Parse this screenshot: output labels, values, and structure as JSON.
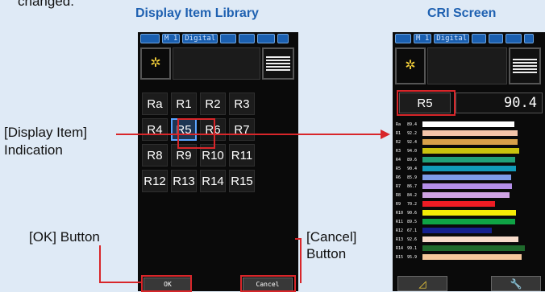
{
  "top_note": "changed.",
  "titles": {
    "library": "Display Item Library",
    "cri": "CRI Screen"
  },
  "annotations": {
    "display_item_line1": "[Display Item]",
    "display_item_line2": "Indication",
    "ok_button": "[OK] Button",
    "cancel_line1": "[Cancel]",
    "cancel_line2": "Button"
  },
  "status_bar": {
    "mode": "M 1",
    "digital": "Digital"
  },
  "icons": {
    "header_left": "sun-icon",
    "header_right": "list-menu-icon",
    "bottom_left": "triangle-ruler-icon",
    "bottom_right": "wrench-icon"
  },
  "library": {
    "items": [
      "Ra",
      "R1",
      "R2",
      "R3",
      "R4",
      "R5",
      "R6",
      "R7",
      "R8",
      "R9",
      "R10",
      "R11",
      "R12",
      "R13",
      "R14",
      "R15"
    ],
    "selected": "R5",
    "ok_label": "OK",
    "cancel_label": "Cancel"
  },
  "cri": {
    "item_label": "R5",
    "item_value": "90.4",
    "rows": [
      {
        "name": "Ra",
        "value": "89.4",
        "color": "#ffffff"
      },
      {
        "name": "R1",
        "value": "92.2",
        "color": "#f3c4a9"
      },
      {
        "name": "R2",
        "value": "92.4",
        "color": "#d7a04a"
      },
      {
        "name": "R3",
        "value": "94.0",
        "color": "#c9c20e"
      },
      {
        "name": "R4",
        "value": "89.6",
        "color": "#22a07a"
      },
      {
        "name": "R5",
        "value": "90.4",
        "color": "#119ab9"
      },
      {
        "name": "R6",
        "value": "85.9",
        "color": "#7e9be8"
      },
      {
        "name": "R7",
        "value": "86.7",
        "color": "#b48ee8"
      },
      {
        "name": "R8",
        "value": "84.2",
        "color": "#cfa3e3"
      },
      {
        "name": "R9",
        "value": "70.2",
        "color": "#ee1c24"
      },
      {
        "name": "R10",
        "value": "90.6",
        "color": "#f5ec06"
      },
      {
        "name": "R11",
        "value": "89.5",
        "color": "#0fa345"
      },
      {
        "name": "R12",
        "value": "67.1",
        "color": "#14208e"
      },
      {
        "name": "R13",
        "value": "92.6",
        "color": "#f8dccb"
      },
      {
        "name": "R14",
        "value": "99.1",
        "color": "#1f6a2c"
      },
      {
        "name": "R15",
        "value": "95.9",
        "color": "#f5c79c"
      }
    ]
  },
  "colors": {
    "accent": "#1f61b1",
    "highlight": "#d8262a",
    "selected_border": "#5aa3ff"
  }
}
